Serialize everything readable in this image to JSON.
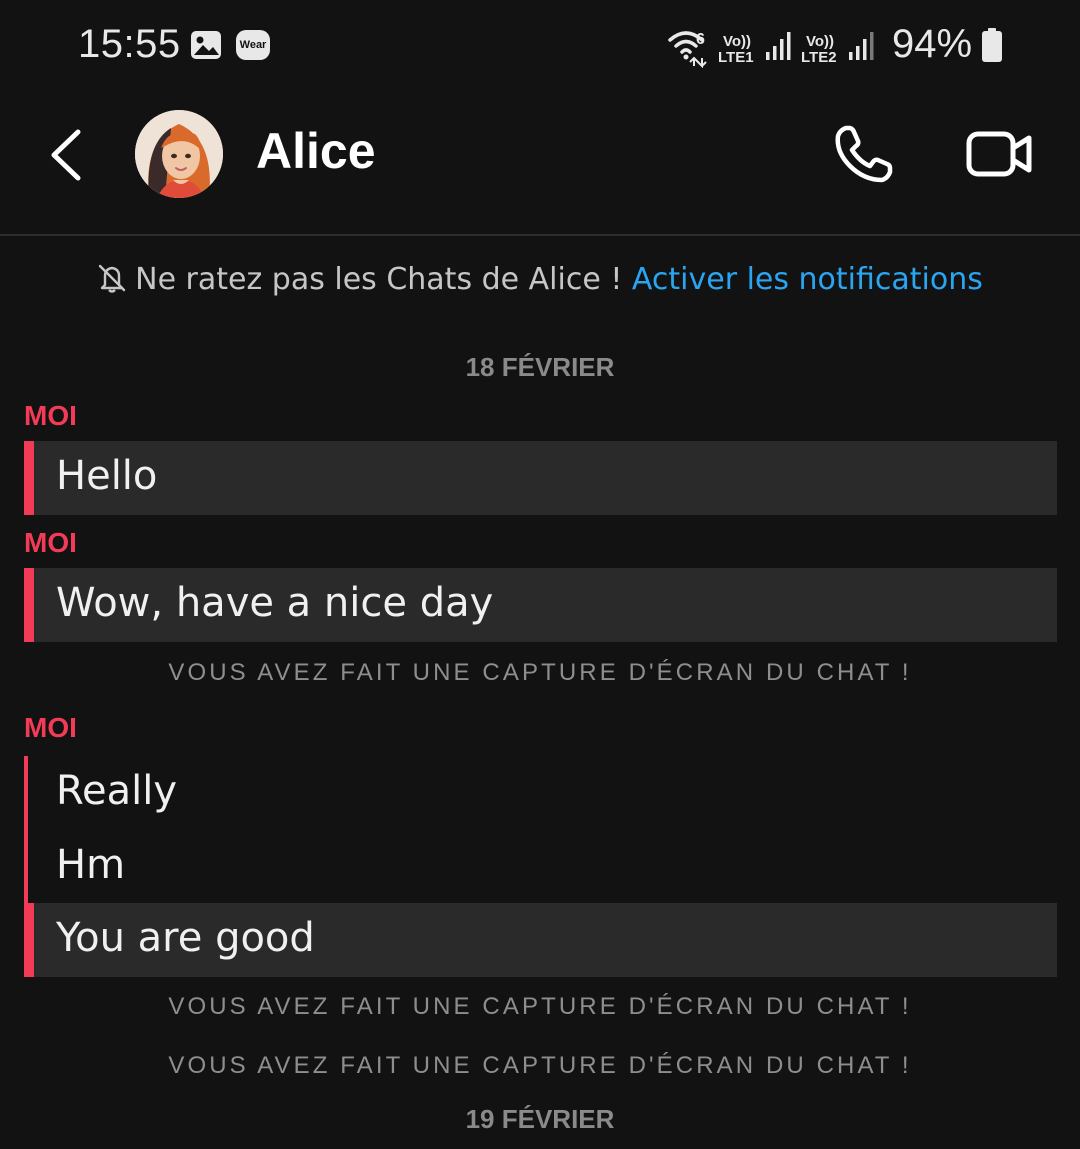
{
  "status_bar": {
    "time": "15:55",
    "wear_label": "Wear",
    "battery": "94%",
    "network_labels": [
      "6",
      "Vo))",
      "LTE1",
      "Vo))",
      "LTE2"
    ]
  },
  "header": {
    "contact_name": "Alice"
  },
  "notification_prompt": {
    "text": "Ne ratez pas les Chats de Alice !",
    "link": "Activer les notifications"
  },
  "conversation": {
    "date_1": "18 FÉVRIER",
    "sender_1": "MOI",
    "msg_1": "Hello",
    "sender_2": "MOI",
    "msg_2": "Wow, have a nice day",
    "note_1": "VOUS AVEZ FAIT UNE CAPTURE D'ÉCRAN DU CHAT !",
    "sender_3": "MOI",
    "msg_3": "Really",
    "msg_4": "Hm",
    "msg_5": "You are good",
    "note_2": "VOUS AVEZ FAIT UNE CAPTURE D'ÉCRAN DU CHAT !",
    "note_3": "VOUS AVEZ FAIT UNE CAPTURE D'ÉCRAN DU CHAT !",
    "date_2": "19 FÉVRIER"
  },
  "colors": {
    "background": "#121212",
    "accent_red": "#f23c57",
    "link_blue": "#2aa5f2",
    "bubble_highlight": "#2a2a2b"
  }
}
